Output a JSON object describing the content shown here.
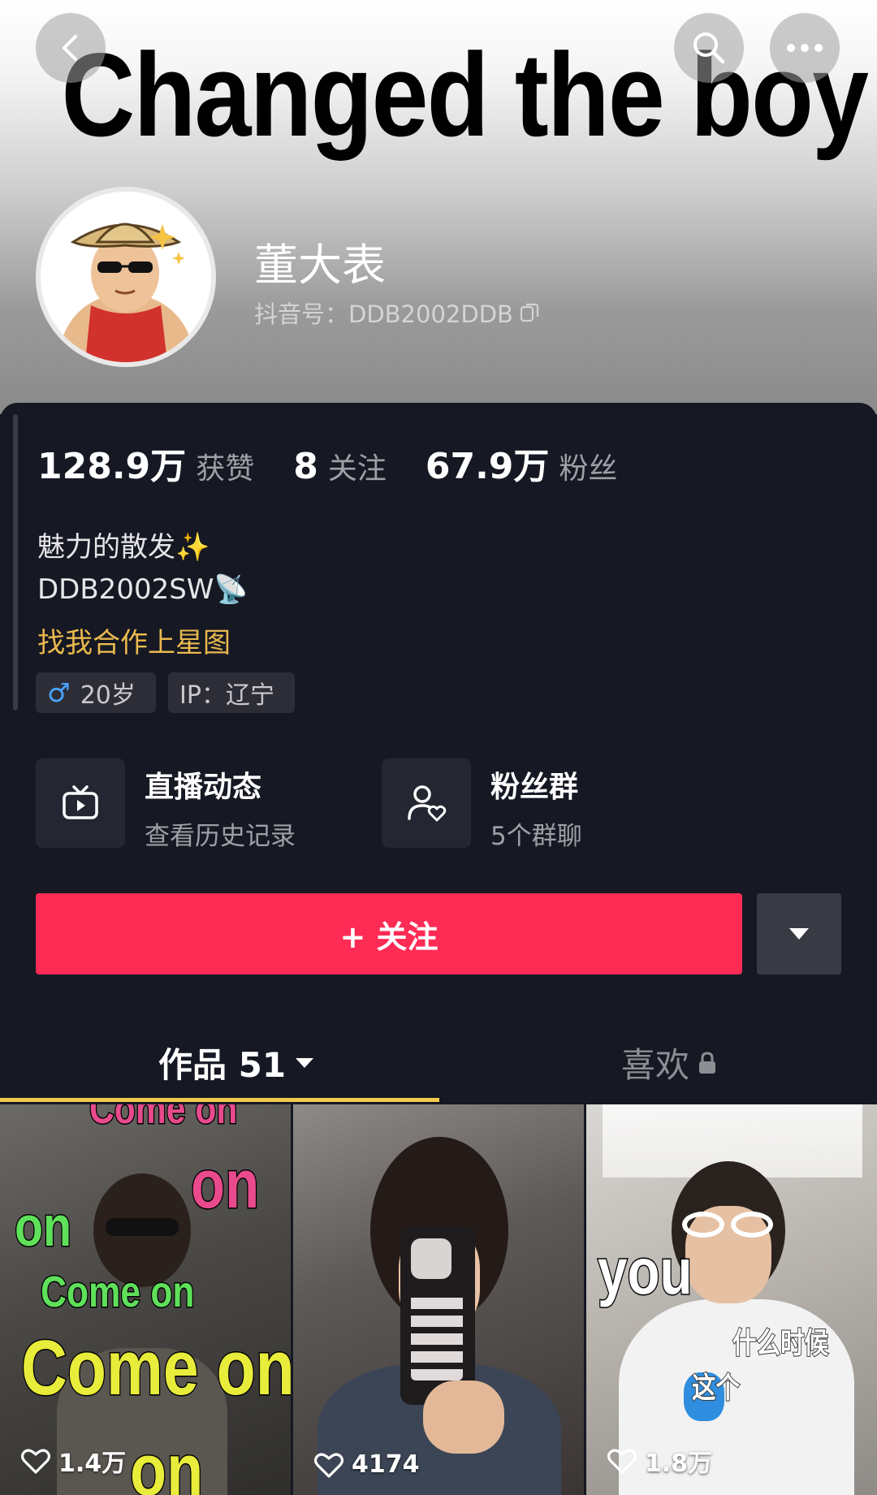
{
  "header": {
    "meme_title": "Changed the boy",
    "back_icon": "chevron-left-icon",
    "search_icon": "search-icon",
    "more_icon": "more-dots-icon"
  },
  "profile": {
    "nickname": "董大表",
    "douyin_id": "抖音号：DDB2002DDB",
    "copy_icon": "copy-icon"
  },
  "stats": [
    {
      "value": "128.9万",
      "label": "获赞"
    },
    {
      "value": "8",
      "label": "关注"
    },
    {
      "value": "67.9万",
      "label": "粉丝"
    }
  ],
  "bio": {
    "line1": "魅力的散发",
    "line2": "DDB2002SW",
    "line3": "找我合作上星图"
  },
  "tags": {
    "gender_age": "20岁",
    "ip": "IP：辽宁"
  },
  "features": {
    "live": {
      "title": "直播动态",
      "subtitle": "查看历史记录"
    },
    "fans": {
      "title": "粉丝群",
      "subtitle": "5个群聊"
    }
  },
  "actions": {
    "follow_label": "+ 关注"
  },
  "tabs": {
    "works": "作品 51",
    "likes": "喜欢"
  },
  "videos": [
    {
      "likes": "1.4万",
      "captions": [
        "Come on",
        "on",
        "on",
        "Come on",
        "Come on",
        "on"
      ]
    },
    {
      "likes": "4174"
    },
    {
      "likes": "1.8万",
      "captions": [
        "you",
        "什么时候",
        "这个"
      ]
    }
  ],
  "colors": {
    "background": "#161823",
    "follow_button": "#fe2c55",
    "tab_underline": "#f2c94c",
    "link_text": "#e9b94d"
  }
}
